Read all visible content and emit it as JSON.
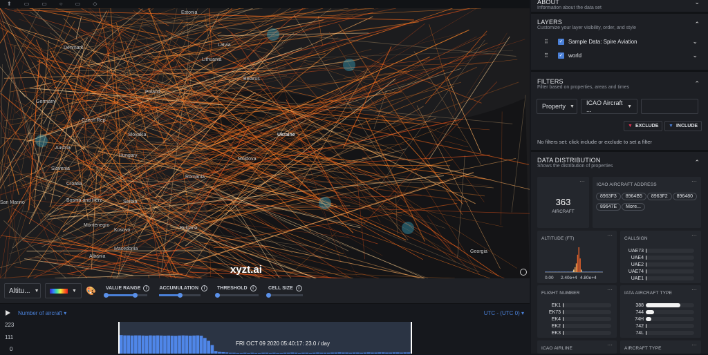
{
  "toolbar_icons": [
    "pin-icon",
    "save-icon",
    "comment-icon",
    "globe-icon",
    "share-icon",
    "tag-icon"
  ],
  "map": {
    "labels": [
      "Estonia",
      "Latvia",
      "Denmark",
      "Lithuania",
      "Belarus",
      "Poland",
      "Germany",
      "Czech Rep",
      "Slovakia",
      "Austria",
      "Hungary",
      "Slovenia",
      "Ukraine",
      "Moldova",
      "Romania",
      "Croatia",
      "Bosnia and Herz",
      "Serbia",
      "San Marino",
      "Montenegro",
      "Kosovo",
      "Bulgaria",
      "Macedonia",
      "Albania",
      "Georgia"
    ],
    "watermark": "xyzt.ai"
  },
  "controls": {
    "property_select": "Altitu...",
    "sliders": [
      {
        "label": "VALUE RANGE",
        "min": 0.0,
        "max": 0.7
      },
      {
        "label": "ACCUMULATION",
        "value": 0.5
      },
      {
        "label": "THRESHOLD",
        "value": 0.0
      },
      {
        "label": "CELL SIZE",
        "value": 0.0
      }
    ]
  },
  "timeline": {
    "metric": "Number of aircraft",
    "timezone": "UTC - (UTC 0)",
    "y_ticks": [
      "223",
      "111",
      "0"
    ],
    "cursor_label": "FRI OCT 09 2020 05:40:17: 23.0 / day",
    "counts": [
      130,
      128,
      128,
      127,
      128,
      128,
      127,
      126,
      128,
      127,
      128,
      127,
      126,
      127,
      126,
      125,
      127,
      128,
      127,
      126,
      127,
      128,
      126,
      110,
      90,
      60,
      18,
      12,
      10,
      8,
      6,
      6,
      5,
      5,
      6,
      5,
      6,
      5,
      5,
      6,
      6,
      5,
      6,
      5,
      5,
      6,
      6,
      7,
      6,
      5,
      6,
      6,
      5,
      6,
      7,
      6,
      6,
      6,
      7,
      7,
      8,
      7,
      7,
      6,
      7,
      7,
      6,
      7,
      8,
      7,
      7,
      8,
      8,
      7,
      7,
      8,
      8,
      7,
      8,
      8
    ]
  },
  "sidebar": {
    "about": {
      "title": "ABOUT",
      "subtitle": "Information about the data set"
    },
    "layers": {
      "title": "LAYERS",
      "subtitle": "Customize your layer visibility, order, and style",
      "items": [
        {
          "label": "Sample Data: Spire Aviation",
          "checked": true
        },
        {
          "label": "world",
          "checked": true
        }
      ]
    },
    "filters": {
      "title": "FILTERS",
      "subtitle": "Filter based on properties, areas and times",
      "type_select": "Property",
      "property_select": "ICAO Aircraft ...",
      "value": "",
      "exclude": "EXCLUDE",
      "include": "INCLUDE",
      "status": "No filters set: click include or exclude to set a filter"
    },
    "distribution": {
      "title": "DATA DISTRIBUTION",
      "subtitle": "Shows the distribution of properties",
      "count": {
        "value": "363",
        "label": "AIRCRAFT"
      },
      "icao_address": {
        "title": "ICAO AIRCRAFT ADDRESS",
        "values": [
          "8963F3",
          "8964B5",
          "8963F2",
          "896480",
          "89647E",
          "More..."
        ]
      },
      "altitude": {
        "title": "ALTITUDE (FT)",
        "ticks": [
          "0.00",
          "2.40e+4",
          "4.80e+4"
        ],
        "bins": [
          1,
          1,
          1,
          1,
          1,
          1,
          1,
          1,
          1,
          1,
          1,
          1,
          1,
          1,
          1,
          1,
          1,
          1,
          1,
          1,
          1,
          2,
          4,
          8,
          14,
          28,
          40,
          22,
          4,
          1,
          1,
          1,
          1,
          1,
          1,
          1,
          1,
          1,
          1,
          1,
          1,
          1,
          1,
          1,
          1
        ]
      },
      "callsign": {
        "title": "CALLSIGN",
        "rows": [
          {
            "k": "UAE73",
            "v": 0.02
          },
          {
            "k": "UAE4",
            "v": 0.02
          },
          {
            "k": "UAE2",
            "v": 0.02
          },
          {
            "k": "UAE74",
            "v": 0.02
          },
          {
            "k": "UAE1",
            "v": 0.02
          }
        ]
      },
      "flight_number": {
        "title": "FLIGHT NUMBER",
        "rows": [
          {
            "k": "EK1",
            "v": 0.02
          },
          {
            "k": "EK73",
            "v": 0.02
          },
          {
            "k": "EK4",
            "v": 0.02
          },
          {
            "k": "EK2",
            "v": 0.02
          },
          {
            "k": "EK3",
            "v": 0.02
          }
        ]
      },
      "iata_type": {
        "title": "IATA AIRCRAFT TYPE",
        "rows": [
          {
            "k": "388",
            "v": 0.72
          },
          {
            "k": "744",
            "v": 0.17
          },
          {
            "k": "74H",
            "v": 0.12
          },
          {
            "k": "742",
            "v": 0
          },
          {
            "k": "74L",
            "v": 0
          }
        ]
      },
      "icao_airline": {
        "title": "ICAO AIRLINE"
      },
      "aircraft_type": {
        "title": "AIRCRAFT TYPE"
      }
    }
  }
}
